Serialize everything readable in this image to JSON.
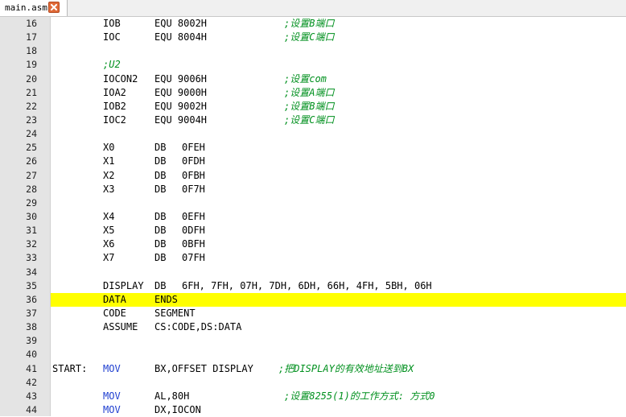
{
  "tab": {
    "label": "main.asm",
    "close_icon": "close-icon"
  },
  "colors": {
    "highlight": "#ffff00",
    "comment": "#00901e",
    "instruction": "#1f3fd0",
    "close_button": "#e06a38"
  },
  "lines": [
    {
      "num": "16",
      "name": "IOB",
      "op": "EQU 8002H",
      "comment": ";设置B端口"
    },
    {
      "num": "17",
      "name": "IOC",
      "op": "EQU 8004H",
      "comment": ";设置C端口"
    },
    {
      "num": "18"
    },
    {
      "num": "19",
      "comment": ";U2"
    },
    {
      "num": "20",
      "name": "IOCON2",
      "op": "EQU 9006H",
      "comment": ";设置com"
    },
    {
      "num": "21",
      "name": "IOA2",
      "op": "EQU 9000H",
      "comment": ";设置A端口"
    },
    {
      "num": "22",
      "name": "IOB2",
      "op": "EQU 9002H",
      "comment": ";设置B端口"
    },
    {
      "num": "23",
      "name": "IOC2",
      "op": "EQU 9004H",
      "comment": ";设置C端口"
    },
    {
      "num": "24"
    },
    {
      "num": "25",
      "name": "X0",
      "op": "DB",
      "arg": "0FEH"
    },
    {
      "num": "26",
      "name": "X1",
      "op": "DB",
      "arg": "0FDH"
    },
    {
      "num": "27",
      "name": "X2",
      "op": "DB",
      "arg": "0FBH"
    },
    {
      "num": "28",
      "name": "X3",
      "op": "DB",
      "arg": "0F7H"
    },
    {
      "num": "29"
    },
    {
      "num": "30",
      "name": "X4",
      "op": "DB",
      "arg": "0EFH"
    },
    {
      "num": "31",
      "name": "X5",
      "op": "DB",
      "arg": "0DFH"
    },
    {
      "num": "32",
      "name": "X6",
      "op": "DB",
      "arg": "0BFH"
    },
    {
      "num": "33",
      "name": "X7",
      "op": "DB",
      "arg": "07FH"
    },
    {
      "num": "34"
    },
    {
      "num": "35",
      "name": "DISPLAY",
      "op": "DB",
      "arg": "6FH, 7FH, 07H, 7DH, 6DH, 66H, 4FH, 5BH, 06H"
    },
    {
      "num": "36",
      "name": "DATA",
      "op": "ENDS",
      "highlight": true
    },
    {
      "num": "37",
      "name": "CODE",
      "op": "SEGMENT"
    },
    {
      "num": "38",
      "name": "ASSUME",
      "op": "CS:CODE,DS:DATA"
    },
    {
      "num": "39"
    },
    {
      "num": "40"
    },
    {
      "num": "41",
      "label": "START:",
      "instr": "MOV",
      "arg": "BX,OFFSET DISPLAY",
      "comment": ";把DISPLAY的有效地址送到BX"
    },
    {
      "num": "42"
    },
    {
      "num": "43",
      "instr": "MOV",
      "arg": "AL,80H",
      "comment": ";设置8255(1)的工作方式: 方式0"
    },
    {
      "num": "44",
      "instr": "MOV",
      "arg": "DX,IOCON"
    }
  ]
}
